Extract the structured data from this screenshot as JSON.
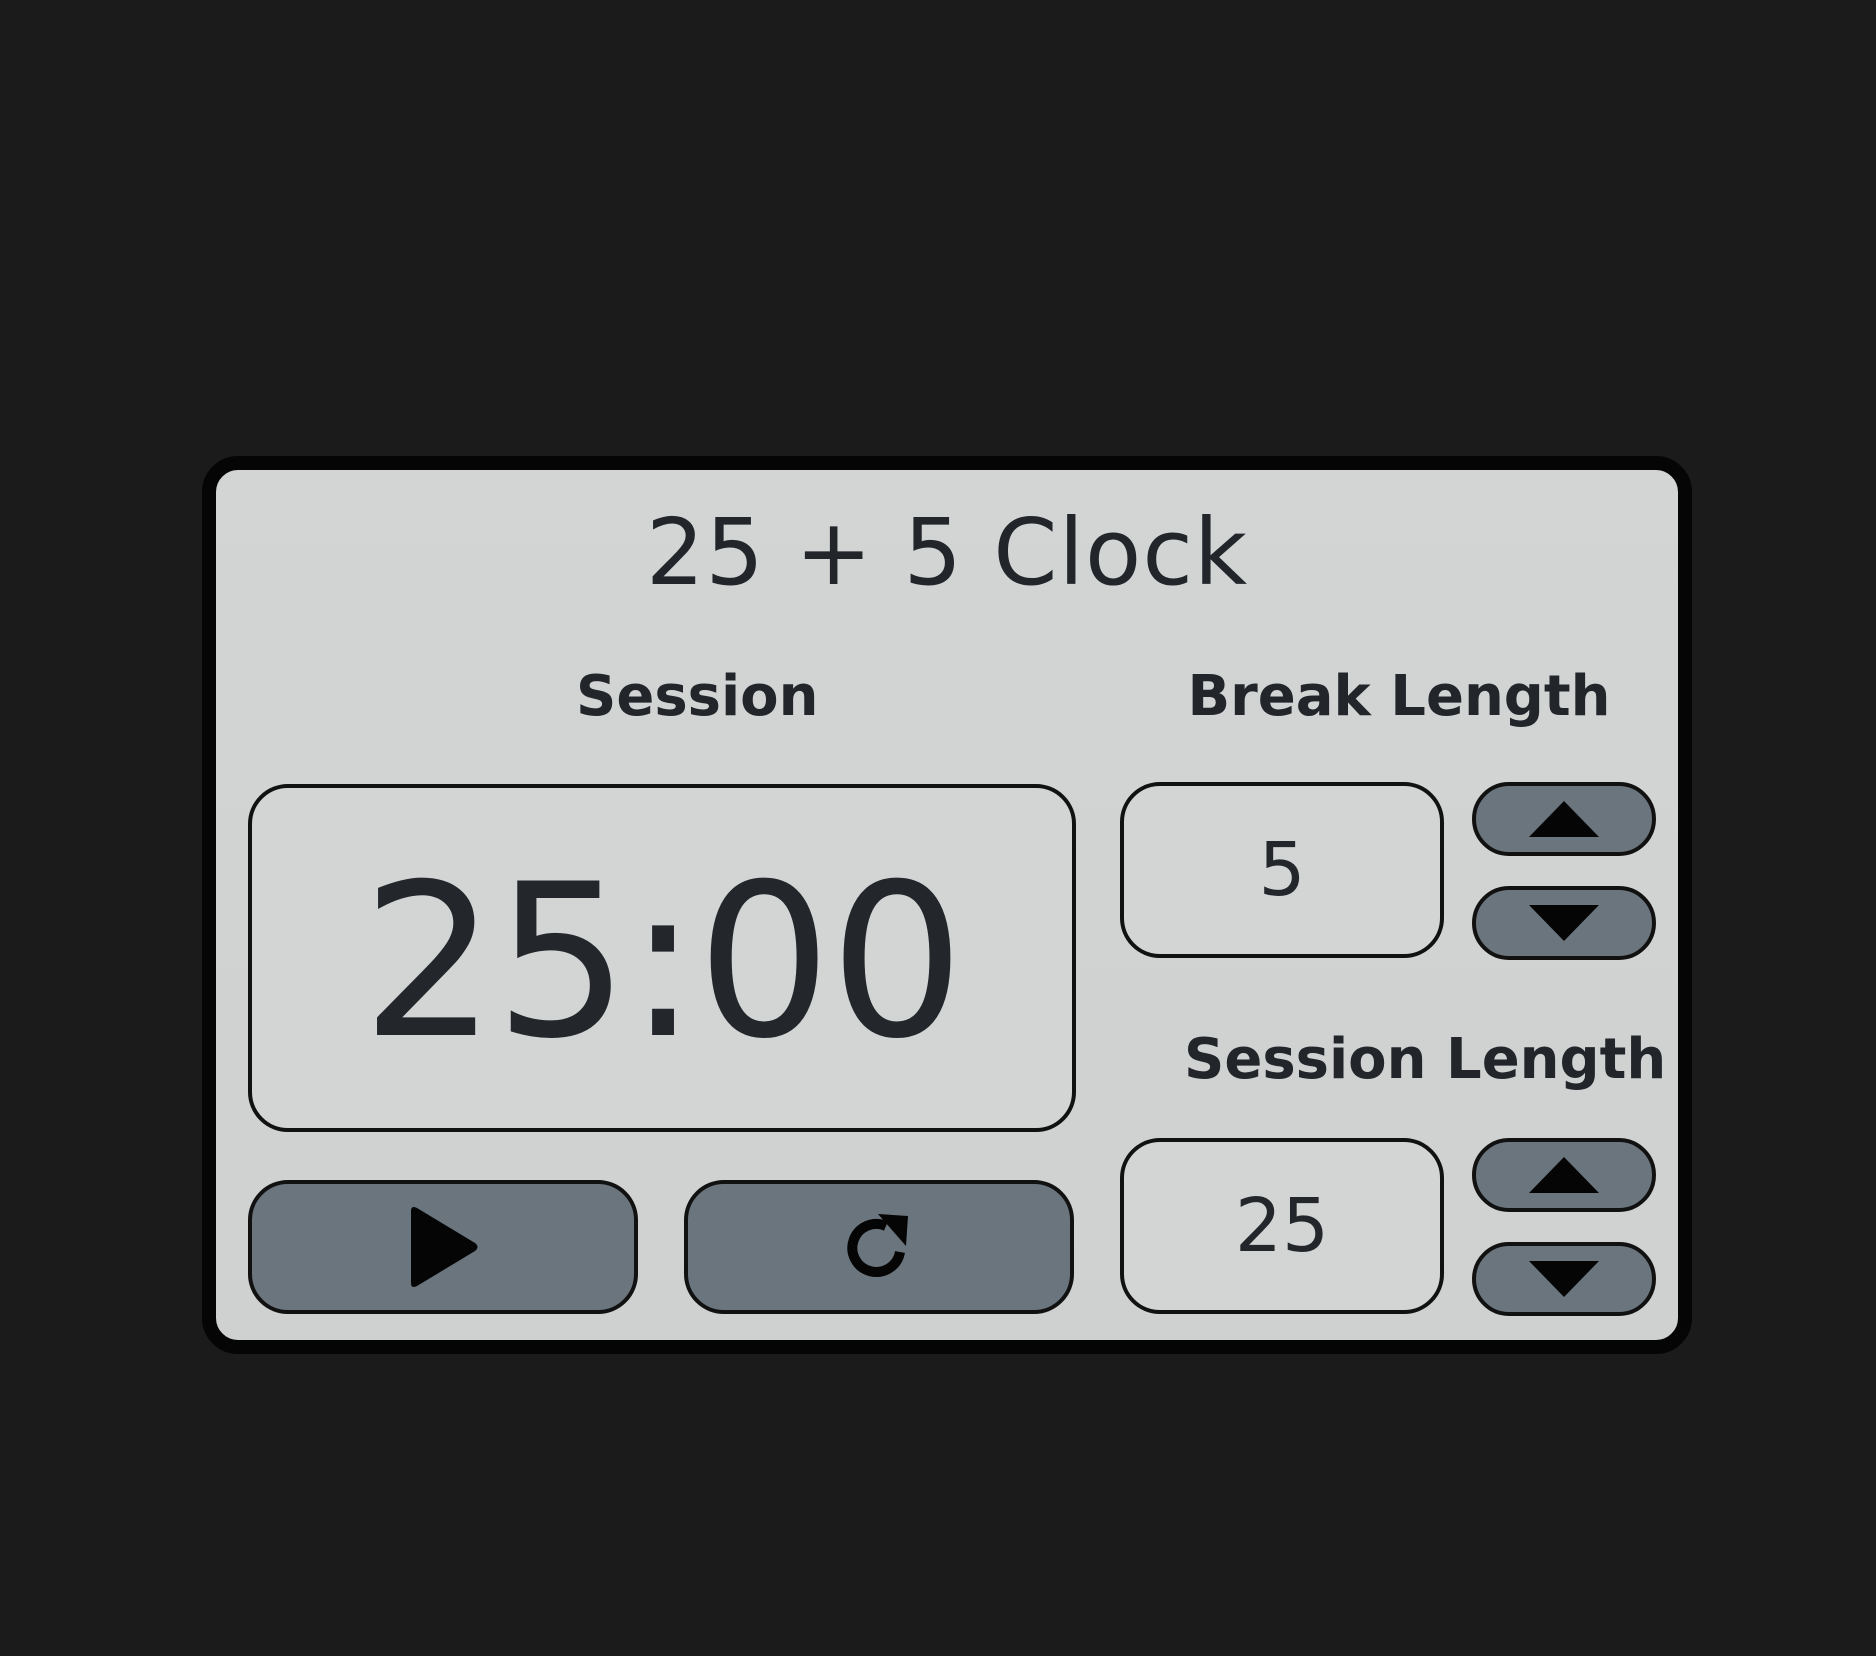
{
  "app": {
    "title": "25 + 5 Clock"
  },
  "timer": {
    "label": "Session",
    "time": "25:00"
  },
  "break": {
    "label": "Break Length",
    "value": "5"
  },
  "session": {
    "label": "Session Length",
    "value": "25"
  },
  "controls": {
    "play_icon": "play-icon",
    "reset_icon": "refresh-icon",
    "increment_icon": "triangle-up-icon",
    "decrement_icon": "triangle-down-icon"
  },
  "colors": {
    "background": "#1b1b1c",
    "panel": "#d3d4d4",
    "button": "#6b757e",
    "text": "#22262b",
    "border": "#050505"
  }
}
